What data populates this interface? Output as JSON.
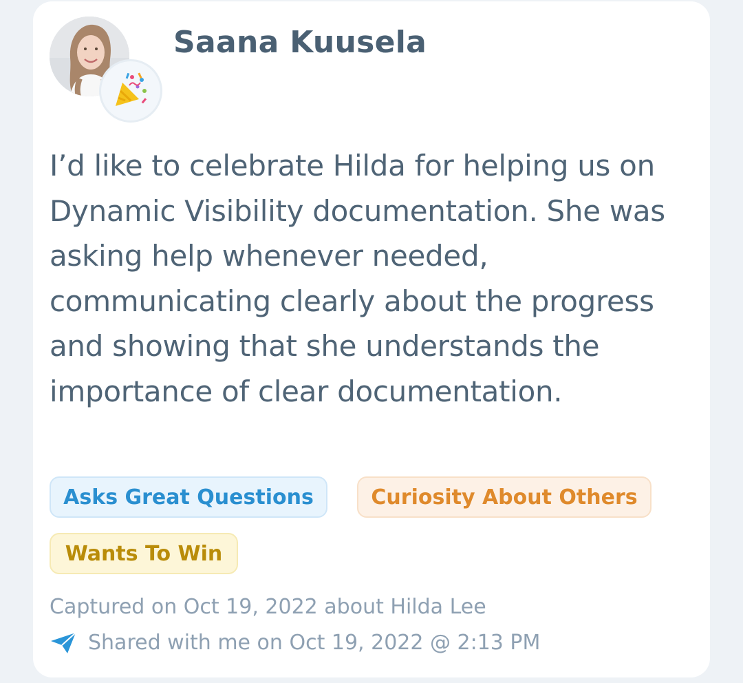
{
  "post": {
    "author_name": "Saana Kuusela",
    "avatar_icon": "user-photo",
    "badge_icon": "party-popper-icon",
    "message": "I’d like to celebrate Hilda for helping us on Dynamic Visibility documentation. She was asking help whenever needed, communicating clearly about the progress and showing that she understands the importance of clear documentation.",
    "tags": [
      {
        "label": "Asks Great Questions",
        "color": "#2a8fd0"
      },
      {
        "label": "Curiosity About Others",
        "color": "#df8a2c"
      },
      {
        "label": "Wants To Win",
        "color": "#b98c09"
      }
    ],
    "captured_text": "Captured on Oct 19, 2022 about Hilda Lee",
    "shared_icon": "send-icon",
    "shared_text": "Shared with me on Oct 19, 2022 @ 2:13 PM"
  }
}
